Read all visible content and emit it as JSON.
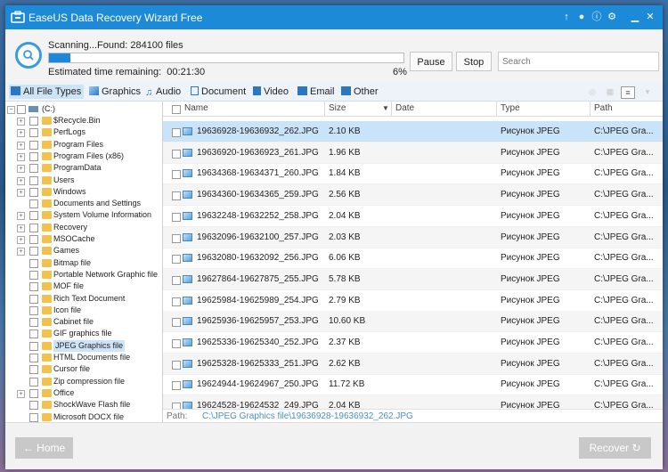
{
  "window": {
    "title": "EaseUS Data Recovery Wizard Free"
  },
  "scan": {
    "status": "Scanning...Found: 284100 files",
    "progress_fraction": 0.06,
    "estimated_label": "Estimated time remaining:",
    "estimated_value": "00:21:30",
    "percent": "6%",
    "pause_label": "Pause",
    "stop_label": "Stop",
    "search_placeholder": "Search"
  },
  "filters": [
    {
      "label": "All File Types",
      "icon": "all-files-icon"
    },
    {
      "label": "Graphics",
      "icon": "image-icon"
    },
    {
      "label": "Audio",
      "icon": "music-note-icon"
    },
    {
      "label": "Document",
      "icon": "document-icon"
    },
    {
      "label": "Video",
      "icon": "film-icon"
    },
    {
      "label": "Email",
      "icon": "envelope-icon"
    },
    {
      "label": "Other",
      "icon": "folder-icon"
    }
  ],
  "tree": {
    "root": "(C:)",
    "items": [
      {
        "label": "$Recycle.Bin",
        "expand": true
      },
      {
        "label": "PerfLogs",
        "expand": true
      },
      {
        "label": "Program Files",
        "expand": true
      },
      {
        "label": "Program Files (x86)",
        "expand": true
      },
      {
        "label": "ProgramData",
        "expand": true
      },
      {
        "label": "Users",
        "expand": true
      },
      {
        "label": "Windows",
        "expand": true
      },
      {
        "label": "Documents and Settings",
        "expand": false
      },
      {
        "label": "System Volume Information",
        "expand": true
      },
      {
        "label": "Recovery",
        "expand": true
      },
      {
        "label": "MSOCache",
        "expand": true
      },
      {
        "label": "Games",
        "expand": true
      },
      {
        "label": "Bitmap file",
        "expand": false
      },
      {
        "label": "Portable Network Graphic file",
        "expand": false
      },
      {
        "label": "MOF file",
        "expand": false
      },
      {
        "label": "Rich Text Document",
        "expand": false
      },
      {
        "label": "Icon file",
        "expand": false
      },
      {
        "label": "Cabinet file",
        "expand": false
      },
      {
        "label": "GIF graphics file",
        "expand": false
      },
      {
        "label": "JPEG Graphics file",
        "expand": false,
        "selected": true
      },
      {
        "label": "HTML Documents file",
        "expand": false
      },
      {
        "label": "Cursor file",
        "expand": false
      },
      {
        "label": "Zip compression file",
        "expand": false
      },
      {
        "label": "Office",
        "expand": true
      },
      {
        "label": "ShockWave Flash file",
        "expand": false
      },
      {
        "label": "Microsoft DOCX file",
        "expand": false
      }
    ]
  },
  "table": {
    "columns": {
      "name": "Name",
      "size": "Size",
      "date": "Date",
      "type": "Type",
      "path": "Path"
    },
    "rows": [
      {
        "name": "19636928-19636932_262.JPG",
        "size": "2.10 KB",
        "type": "Рисунок JPEG",
        "path": "C:\\JPEG Gra..."
      },
      {
        "name": "19636920-19636923_261.JPG",
        "size": "1.96 KB",
        "type": "Рисунок JPEG",
        "path": "C:\\JPEG Gra..."
      },
      {
        "name": "19634368-19634371_260.JPG",
        "size": "1.84 KB",
        "type": "Рисунок JPEG",
        "path": "C:\\JPEG Gra..."
      },
      {
        "name": "19634360-19634365_259.JPG",
        "size": "2.56 KB",
        "type": "Рисунок JPEG",
        "path": "C:\\JPEG Gra..."
      },
      {
        "name": "19632248-19632252_258.JPG",
        "size": "2.04 KB",
        "type": "Рисунок JPEG",
        "path": "C:\\JPEG Gra..."
      },
      {
        "name": "19632096-19632100_257.JPG",
        "size": "2.03 KB",
        "type": "Рисунок JPEG",
        "path": "C:\\JPEG Gra..."
      },
      {
        "name": "19632080-19632092_256.JPG",
        "size": "6.06 KB",
        "type": "Рисунок JPEG",
        "path": "C:\\JPEG Gra..."
      },
      {
        "name": "19627864-19627875_255.JPG",
        "size": "5.78 KB",
        "type": "Рисунок JPEG",
        "path": "C:\\JPEG Gra..."
      },
      {
        "name": "19625984-19625989_254.JPG",
        "size": "2.79 KB",
        "type": "Рисунок JPEG",
        "path": "C:\\JPEG Gra..."
      },
      {
        "name": "19625936-19625957_253.JPG",
        "size": "10.60 KB",
        "type": "Рисунок JPEG",
        "path": "C:\\JPEG Gra..."
      },
      {
        "name": "19625336-19625340_252.JPG",
        "size": "2.37 KB",
        "type": "Рисунок JPEG",
        "path": "C:\\JPEG Gra..."
      },
      {
        "name": "19625328-19625333_251.JPG",
        "size": "2.62 KB",
        "type": "Рисунок JPEG",
        "path": "C:\\JPEG Gra..."
      },
      {
        "name": "19624944-19624967_250.JPG",
        "size": "11.72 KB",
        "type": "Рисунок JPEG",
        "path": "C:\\JPEG Gra..."
      },
      {
        "name": "19624528-19624532_249.JPG",
        "size": "2.04 KB",
        "type": "Рисунок JPEG",
        "path": "C:\\JPEG Gra..."
      }
    ]
  },
  "path_bar": {
    "label": "Path:",
    "value": "C:\\JPEG Graphics file\\19636928-19636932_262.JPG"
  },
  "bottom": {
    "home_label": "Home",
    "recover_label": "Recover"
  },
  "colors": {
    "accent": "#1d8ad8",
    "selection": "#c9e3f9",
    "folder": "#f3c24c"
  }
}
